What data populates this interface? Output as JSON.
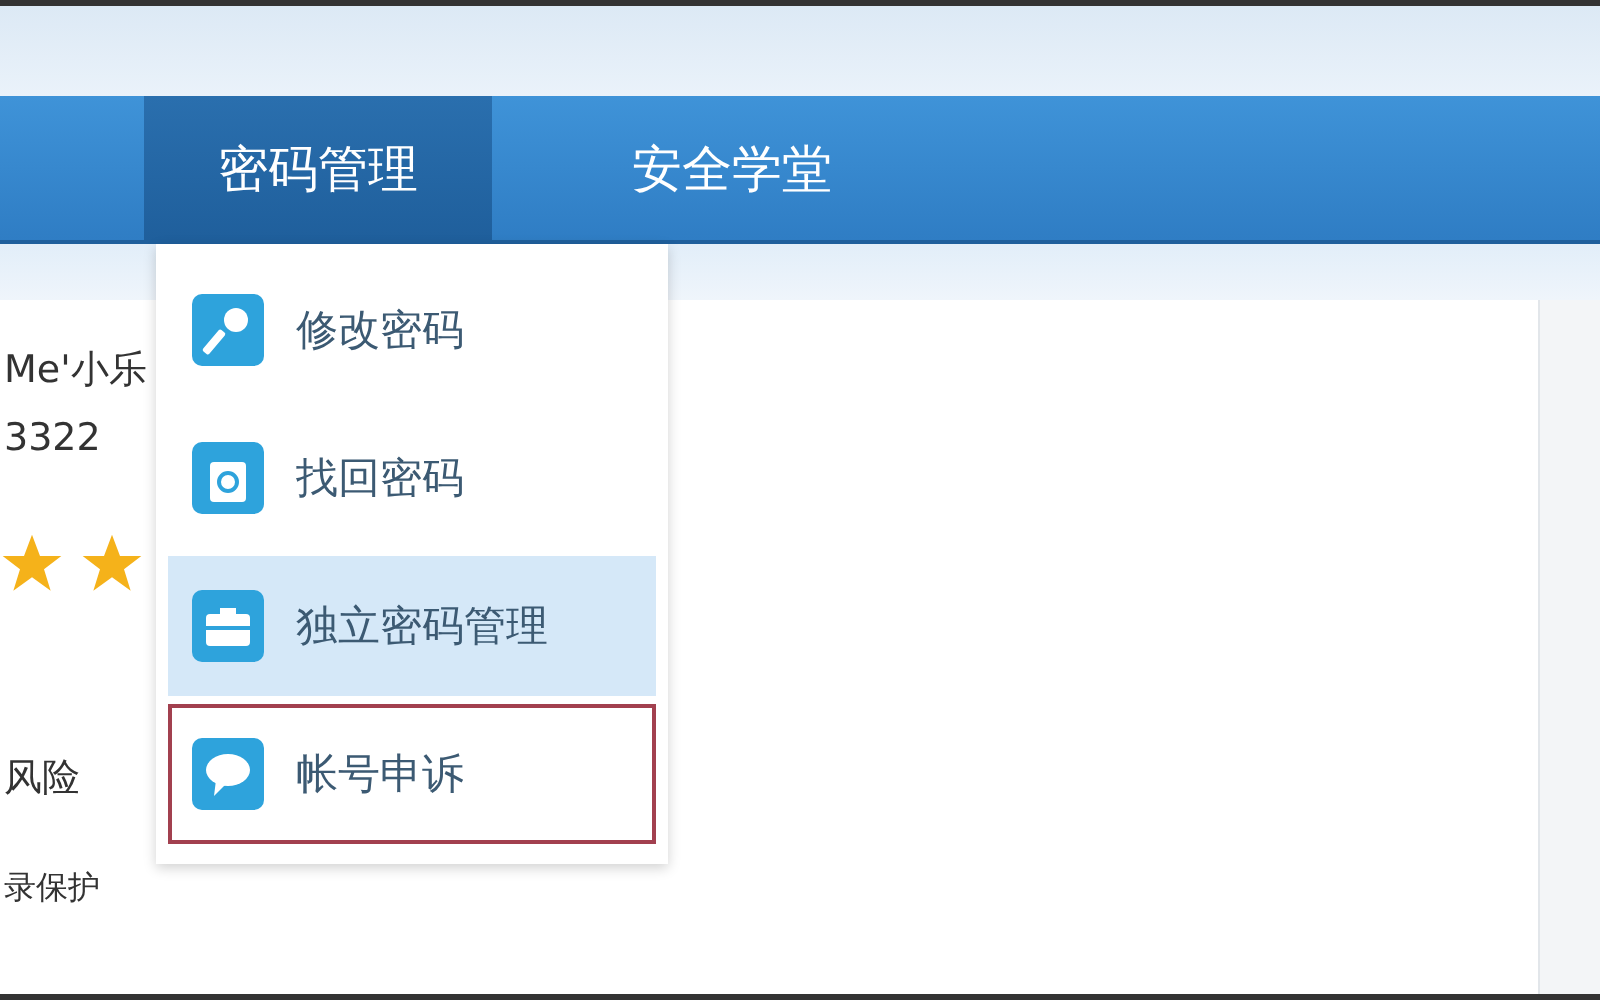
{
  "nav": {
    "tabs": [
      {
        "label": "密码管理",
        "selected": true
      },
      {
        "label": "安全学堂",
        "selected": false
      }
    ]
  },
  "menu": {
    "items": [
      {
        "label": "修改密码",
        "selected": false,
        "outlined": false
      },
      {
        "label": "找回密码",
        "selected": false,
        "outlined": false
      },
      {
        "label": "独立密码管理",
        "selected": true,
        "outlined": false
      },
      {
        "label": "帐号申诉",
        "selected": false,
        "outlined": true
      }
    ]
  },
  "profile": {
    "name": "Me'小乐",
    "number": "3322",
    "risk": "风险",
    "protection": "录保护"
  }
}
